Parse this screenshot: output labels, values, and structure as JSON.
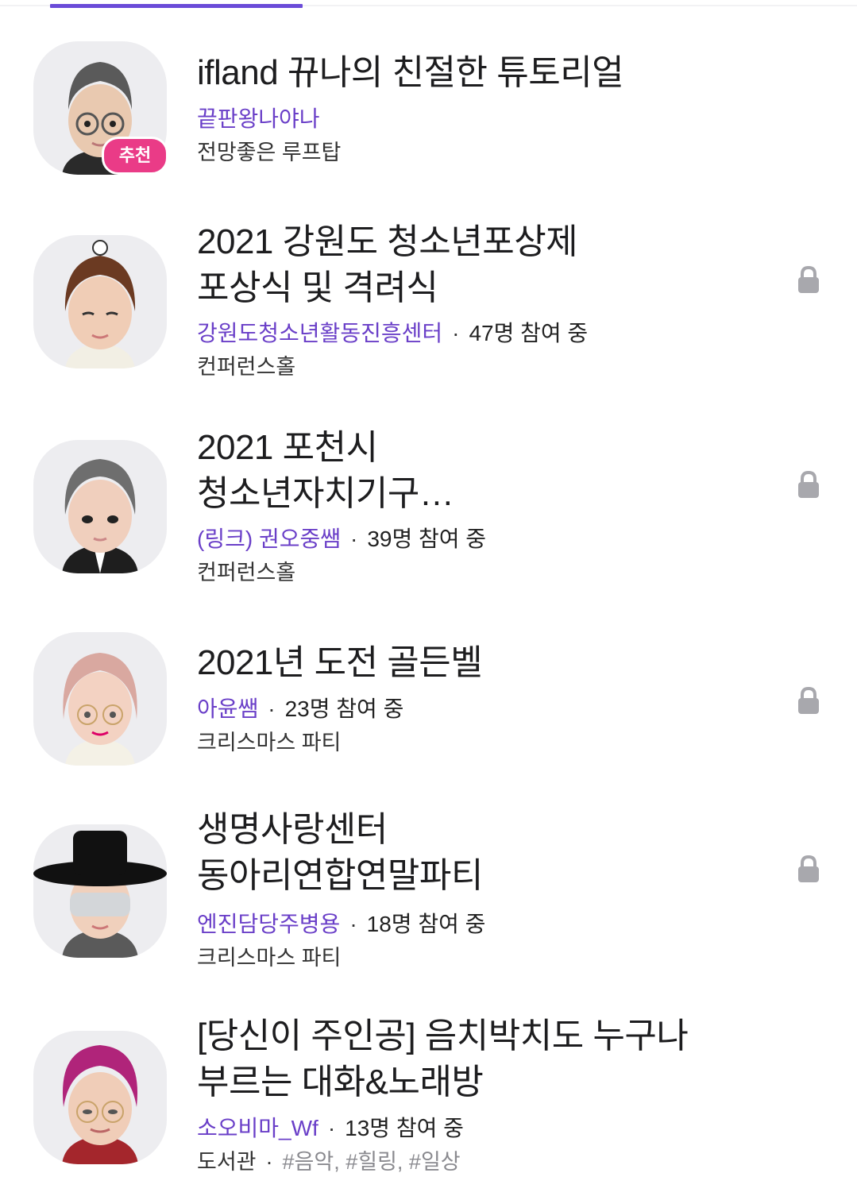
{
  "colors": {
    "accent": "#6a3fc8",
    "tab_indicator": "#6a4bd8",
    "badge": "#ea3b87",
    "avatar_bg": "#ededf0",
    "lock": "#a8a8ad"
  },
  "rooms": [
    {
      "title": "ifland 뀨나의 친절한 튜토리얼",
      "host": "끝판왕나야나",
      "participants": "",
      "place": "전망좋은 루프탑",
      "tags": "",
      "badge": "추천",
      "locked": false,
      "avatar_icon": "avatar-glasses-icon"
    },
    {
      "title": "2021 강원도 청소년포상제\n포상식 및 격려식",
      "host": "강원도청소년활동진흥센터",
      "participants": "47명 참여 중",
      "place": "컨퍼런스홀",
      "tags": "",
      "locked": true,
      "avatar_icon": "avatar-curly-hair-icon"
    },
    {
      "title": "2021 포천시\n청소년자치기구…",
      "host": "(링크) 권오중쌤",
      "participants": "39명 참여 중",
      "place": "컨퍼런스홀",
      "tags": "",
      "locked": true,
      "avatar_icon": "avatar-suit-icon"
    },
    {
      "title": "2021년 도전 골든벨",
      "host": "아윤쌤",
      "participants": "23명 참여 중",
      "place": "크리스마스 파티",
      "tags": "",
      "locked": true,
      "avatar_icon": "avatar-pink-hair-icon"
    },
    {
      "title": "생명사랑센터\n동아리연합연말파티",
      "host": "엔진담당주병용",
      "participants": "18명 참여 중",
      "place": "크리스마스 파티",
      "tags": "",
      "locked": true,
      "avatar_icon": "avatar-gat-hat-icon"
    },
    {
      "title": "[당신이 주인공] 음치박치도 누구나\n부르는 대화&노래방",
      "host": "소오비마_Wf",
      "participants": "13명 참여 중",
      "place": "도서관",
      "tags": "#음악, #힐링, #일상",
      "locked": false,
      "avatar_icon": "avatar-magenta-hair-icon"
    }
  ]
}
